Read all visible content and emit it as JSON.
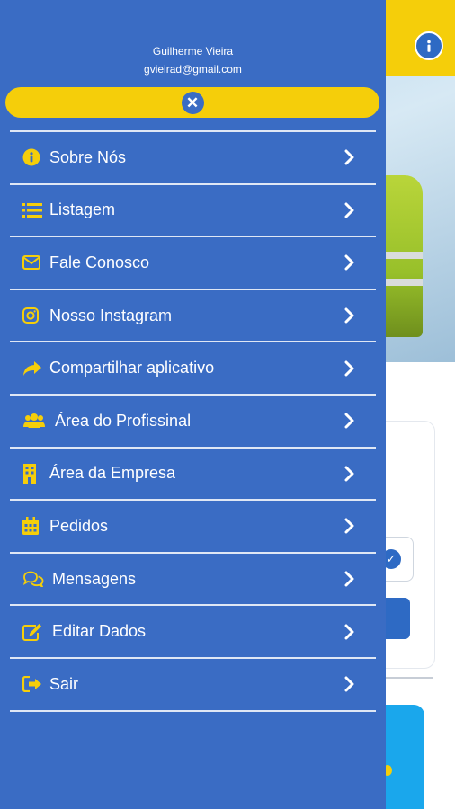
{
  "user": {
    "name": "Guilherme Vieira",
    "email": "gvieirad@gmail.com"
  },
  "colors": {
    "drawer_bg": "#3a6cc4",
    "accent_yellow": "#f5ce0a",
    "text": "#ffffff"
  },
  "menu": {
    "items": [
      {
        "label": "Sobre Nós",
        "icon": "info-circle-icon"
      },
      {
        "label": "Listagem",
        "icon": "list-icon"
      },
      {
        "label": "Fale Conosco",
        "icon": "envelope-icon"
      },
      {
        "label": "Nosso Instagram",
        "icon": "instagram-icon"
      },
      {
        "label": "Compartilhar aplicativo",
        "icon": "share-arrow-icon"
      },
      {
        "label": "Área do Profissinal",
        "icon": "users-icon"
      },
      {
        "label": "Área da Empresa",
        "icon": "building-icon"
      },
      {
        "label": "Pedidos",
        "icon": "calendar-icon"
      },
      {
        "label": "Mensagens",
        "icon": "chat-bubbles-icon"
      },
      {
        "label": "Editar Dados",
        "icon": "edit-icon"
      },
      {
        "label": "Sair",
        "icon": "sign-out-icon"
      }
    ]
  }
}
